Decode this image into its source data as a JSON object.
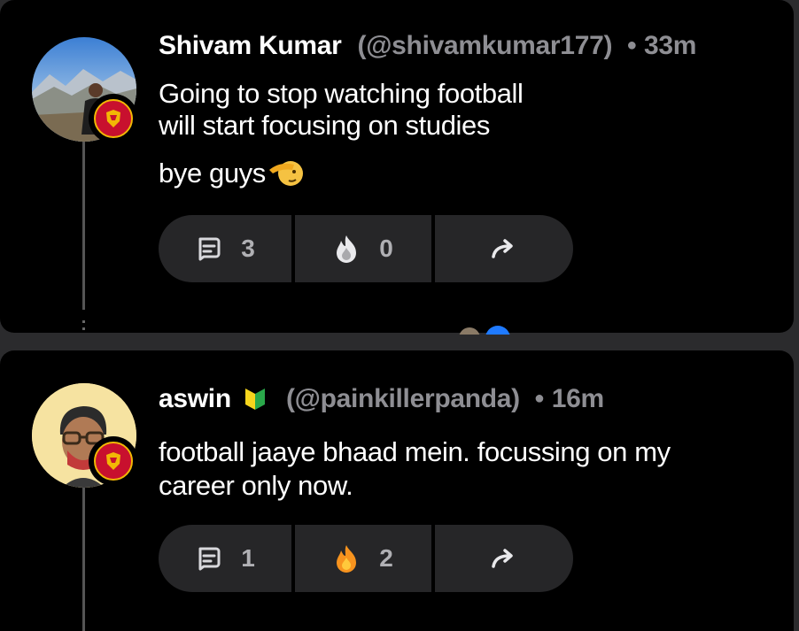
{
  "posts": [
    {
      "name": "Shivam Kumar",
      "handle": "(@shivamkumar177)",
      "time": "33m",
      "lines": [
        "Going to stop watching football",
        "will start focusing on studies"
      ],
      "extra_line": "bye guys",
      "extra_emoji": "salute-face",
      "comments": "3",
      "reactions": "0",
      "reaction_icon": "fire-icon-grey"
    },
    {
      "name": "aswin",
      "name_emoji": "beginner-symbol",
      "handle": "(@painkillerpanda)",
      "time": "16m",
      "lines": [
        "football jaaye bhaad mein. focussing on my",
        "career only now."
      ],
      "comments": "1",
      "reactions": "2",
      "reaction_icon": "fire-icon-orange"
    }
  ],
  "colors": {
    "card_bg": "#000000",
    "page_bg": "#2b2b2d",
    "pill_bg": "#262628",
    "muted": "#8e8e93",
    "fire": "#f7931e",
    "club_red": "#c8102e"
  }
}
